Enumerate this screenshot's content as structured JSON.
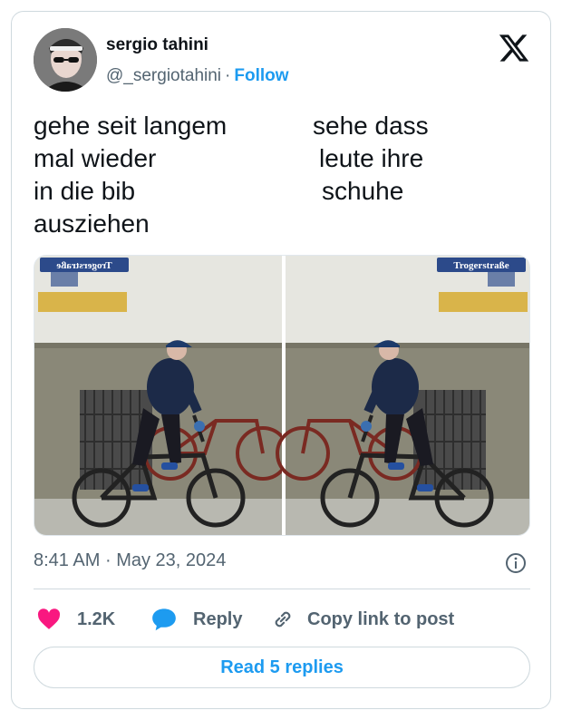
{
  "author": {
    "name": "sergio tahini",
    "handle": "@_sergiotahini",
    "separator": "·",
    "follow_label": "Follow"
  },
  "tweet": {
    "left_lines": [
      "gehe seit langem",
      "mal wieder",
      "in die bib",
      "ausziehen"
    ],
    "right_lines": [
      "sehe dass",
      "leute ihre",
      "schuhe"
    ]
  },
  "media": {
    "sign_left": "Trogerstraße",
    "sign_right": "Trogerstraße"
  },
  "meta": {
    "time": "8:41 AM",
    "separator": "·",
    "date": "May 23, 2024"
  },
  "actions": {
    "like_count": "1.2K",
    "reply_label": "Reply",
    "copy_label": "Copy link to post"
  },
  "read_replies_label": "Read 5 replies",
  "colors": {
    "accent": "#1d9bf0",
    "like": "#f91880",
    "muted": "#536471"
  },
  "icons": [
    "x-logo-icon",
    "info-icon",
    "heart-icon",
    "reply-bubble-icon",
    "link-icon"
  ]
}
